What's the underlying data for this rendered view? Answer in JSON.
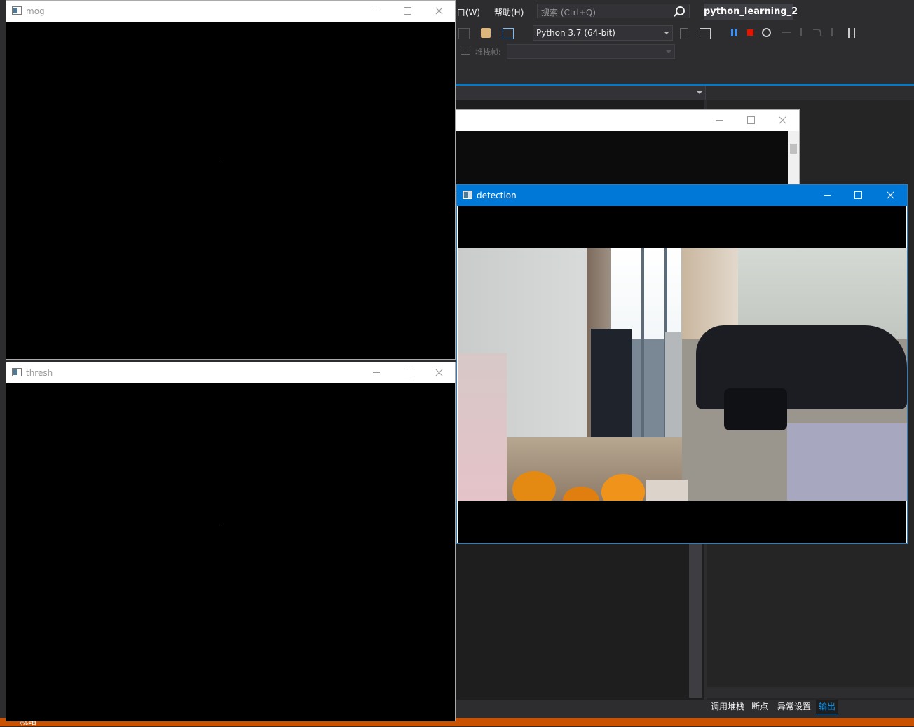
{
  "vs": {
    "menu": {
      "window": "窗口(W)",
      "help": "帮助(H)"
    },
    "search": {
      "placeholder": "搜索 (Ctrl+Q)"
    },
    "project_title": "python_learning_2",
    "toolbar": {
      "environment": "Python 3.7 (64-bit)",
      "stack_frame_label": "堆栈帧:"
    },
    "bottom_tabs": [
      {
        "label": "调用堆栈"
      },
      {
        "label": "断点"
      },
      {
        "label": "异常设置"
      },
      {
        "label": "输出",
        "active": true
      }
    ],
    "status": {
      "text": "就绪"
    },
    "colors": {
      "accent": "#007acc",
      "status_bar": "#ca5100",
      "background": "#2d2d30"
    }
  },
  "windows": {
    "mog": {
      "title": "mog"
    },
    "thresh": {
      "title": "thresh"
    },
    "background_window": {
      "title": ""
    },
    "detection": {
      "title": "detection",
      "active": true
    }
  },
  "icons": [
    "search-icon",
    "minimize-icon",
    "maximize-icon",
    "close-icon",
    "pause-icon",
    "stop-icon",
    "restart-icon",
    "window-app-icon"
  ]
}
